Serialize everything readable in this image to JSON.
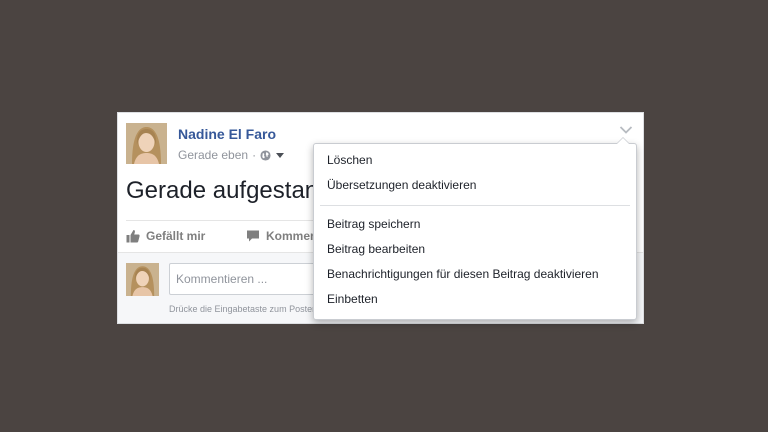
{
  "post": {
    "author_name": "Nadine El Faro",
    "timestamp": "Gerade eben",
    "separator": "·",
    "audience_icon": "globe-icon",
    "text": "Gerade aufgestanden",
    "like_label": "Gefällt mir",
    "comment_label": "Kommentieren"
  },
  "comment_box": {
    "placeholder": "Kommentieren ...",
    "hint": "Drücke die Eingabetaste zum Posten."
  },
  "menu": {
    "group1": [
      "Löschen",
      "Übersetzungen deaktivieren"
    ],
    "group2": [
      "Beitrag speichern",
      "Beitrag bearbeiten",
      "Benachrichtigungen für diesen Beitrag deaktivieren",
      "Einbetten"
    ]
  },
  "colors": {
    "background": "#4b4441",
    "author_link": "#365899",
    "menu_hover": "#4267b2"
  }
}
